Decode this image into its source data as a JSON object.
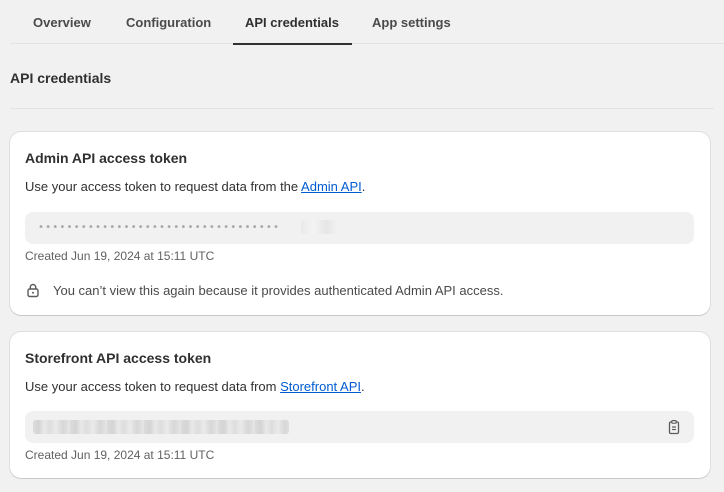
{
  "tabs": [
    {
      "label": "Overview"
    },
    {
      "label": "Configuration"
    },
    {
      "label": "API credentials"
    },
    {
      "label": "App settings"
    }
  ],
  "active_tab": "API credentials",
  "section": {
    "title": "API credentials"
  },
  "admin_card": {
    "title": "Admin API access token",
    "desc_prefix": "Use your access token to request data from the ",
    "desc_link": "Admin API",
    "desc_suffix": ".",
    "token_mask": "••••••••••••••••••••••••••••••••••",
    "created": "Created Jun 19, 2024 at 15:11 UTC",
    "notice": "You can’t view this again because it provides authenticated Admin API access.",
    "notice_icon": "lock-icon"
  },
  "storefront_card": {
    "title": "Storefront API access token",
    "desc_prefix": "Use your access token to request data from ",
    "desc_link": "Storefront API",
    "desc_suffix": ".",
    "created": "Created Jun 19, 2024 at 15:11 UTC",
    "copy_icon": "clipboard-icon"
  },
  "colors": {
    "background": "#f1f1f1",
    "card": "#ffffff",
    "link": "#005bd3",
    "text": "#303030",
    "subdued": "#616161"
  }
}
